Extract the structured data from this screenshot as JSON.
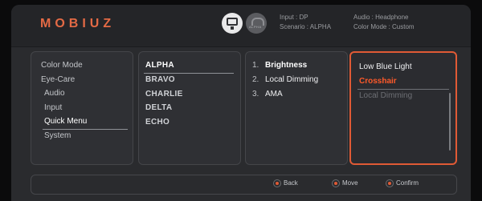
{
  "brand": {
    "logo": "MOBIUZ",
    "accent": "#e05a35"
  },
  "header": {
    "input_label": "Input : DP",
    "scenario_label": "Scenario : ALPHA",
    "audio_label": "Audio : Headphone",
    "color_mode_label": "Color Mode : Custom",
    "scenario_icon_text": "ALPHA",
    "icons": [
      "display-icon",
      "scenario-icon"
    ]
  },
  "main_menu": {
    "items": [
      "Color Mode",
      "Eye-Care",
      "Audio",
      "Input",
      "Quick Menu",
      "System"
    ],
    "selected": "Quick Menu"
  },
  "scenarios": {
    "items": [
      "ALPHA",
      "BRAVO",
      "CHARLIE",
      "DELTA",
      "ECHO"
    ],
    "selected": "ALPHA"
  },
  "quick_menu_slots": [
    {
      "num": "1.",
      "label": "Brightness"
    },
    {
      "num": "2.",
      "label": "Local Dimming"
    },
    {
      "num": "3.",
      "label": "AMA"
    }
  ],
  "slot_options": {
    "items": [
      "Low Blue Light",
      "Crosshair",
      "Local Dimming"
    ],
    "highlighted": "Crosshair",
    "disabled": "Local Dimming"
  },
  "footer": {
    "back": "Back",
    "move": "Move",
    "confirm": "Confirm"
  }
}
